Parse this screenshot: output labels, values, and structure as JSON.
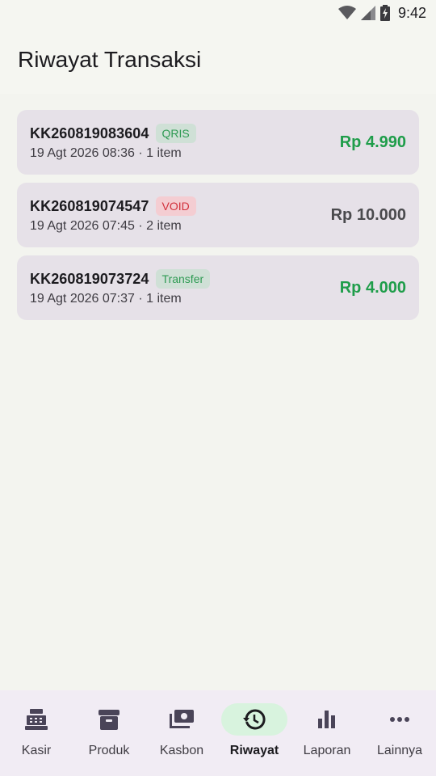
{
  "status_bar": {
    "time": "9:42"
  },
  "header": {
    "title": "Riwayat Transaksi"
  },
  "transactions": [
    {
      "id": "KK260819083604",
      "method": "QRIS",
      "meta": "19 Agt 2026 08:36 · 1 item",
      "amount": "Rp 4.990"
    },
    {
      "id": "KK260819074547",
      "method": "VOID",
      "meta": "19 Agt 2026 07:45 · 2 item",
      "amount": "Rp 10.000"
    },
    {
      "id": "KK260819073724",
      "method": "Transfer",
      "meta": "19 Agt 2026 07:37 · 1 item",
      "amount": "Rp 4.000"
    }
  ],
  "nav": {
    "items": [
      {
        "label": "Kasir",
        "icon": "cash-register-icon"
      },
      {
        "label": "Produk",
        "icon": "archive-box-icon"
      },
      {
        "label": "Kasbon",
        "icon": "payments-icon"
      },
      {
        "label": "Riwayat",
        "icon": "history-icon",
        "active": true
      },
      {
        "label": "Laporan",
        "icon": "bar-chart-icon"
      },
      {
        "label": "Lainnya",
        "icon": "more-horizontal-icon"
      }
    ]
  },
  "colors": {
    "accent_green": "#1f9d4a",
    "void_red": "#d2323d",
    "card_bg": "#e6e1e8",
    "nav_bg": "#f1ecf4",
    "active_pill": "#d8f3de"
  }
}
